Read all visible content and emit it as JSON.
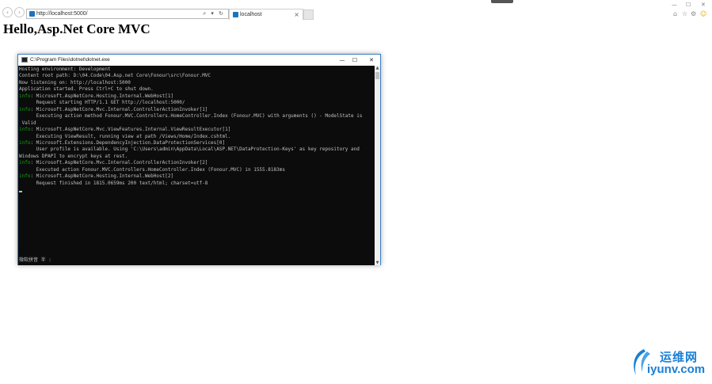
{
  "browser": {
    "address": "http://localhost:5000/",
    "tab_title": "localhost",
    "tab_close": "×",
    "back_icon": "‹",
    "forward_icon": "›",
    "address_tools": "⌕ ▾ ↻",
    "window_controls": {
      "minimize": "—",
      "maximize": "☐",
      "close": "✕"
    },
    "right_icons": {
      "home": "⌂",
      "favorites": "☆",
      "settings": "⚙",
      "feedback": "☺"
    }
  },
  "page": {
    "heading": "Hello,Asp.Net Core MVC"
  },
  "console": {
    "title": "C:\\Program Files\\dotnet\\dotnet.exe",
    "buttons": {
      "minimize": "—",
      "maximize": "☐",
      "close": "✕"
    },
    "lines": [
      {
        "tag": "",
        "text": "Hosting environment: Development"
      },
      {
        "tag": "",
        "text": "Content root path: D:\\04.Code\\04.Asp.net Core\\Fonour\\src\\Fonour.MVC"
      },
      {
        "tag": "",
        "text": "Now listening on: http://localhost:5000"
      },
      {
        "tag": "",
        "text": "Application started. Press Ctrl+C to shut down."
      },
      {
        "tag": "info",
        "text": ": Microsoft.AspNetCore.Hosting.Internal.WebHost[1]"
      },
      {
        "tag": "",
        "text": "      Request starting HTTP/1.1 GET http://localhost:5000/"
      },
      {
        "tag": "info",
        "text": ": Microsoft.AspNetCore.Mvc.Internal.ControllerActionInvoker[1]"
      },
      {
        "tag": "",
        "text": "      Executing action method Fonour.MVC.Controllers.HomeController.Index (Fonour.MVC) with arguments () - ModelState is"
      },
      {
        "tag": "",
        "text": " Valid"
      },
      {
        "tag": "info",
        "text": ": Microsoft.AspNetCore.Mvc.ViewFeatures.Internal.ViewResultExecutor[1]"
      },
      {
        "tag": "",
        "text": "      Executing ViewResult, running view at path /Views/Home/Index.cshtml."
      },
      {
        "tag": "info",
        "text": ": Microsoft.Extensions.DependencyInjection.DataProtectionServices[0]"
      },
      {
        "tag": "",
        "text": "      User profile is available. Using 'C:\\Users\\admin\\AppData\\Local\\ASP.NET\\DataProtection-Keys' as key repository and"
      },
      {
        "tag": "",
        "text": "Windows DPAPI to encrypt keys at rest."
      },
      {
        "tag": "info",
        "text": ": Microsoft.AspNetCore.Mvc.Internal.ControllerActionInvoker[2]"
      },
      {
        "tag": "",
        "text": "      Executed action Fonour.MVC.Controllers.HomeController.Index (Fonour.MVC) in 1555.8183ms"
      },
      {
        "tag": "info",
        "text": ": Microsoft.AspNetCore.Hosting.Internal.WebHost[2]"
      },
      {
        "tag": "",
        "text": "      Request finished in 1815.0659ms 200 text/html; charset=utf-8"
      }
    ],
    "ime_status": "微软拼音 半 :",
    "tag_color": "#13a10e"
  },
  "watermark": {
    "cn": "运维网",
    "en": "iyunv.com",
    "color": "#1a7fd4"
  }
}
